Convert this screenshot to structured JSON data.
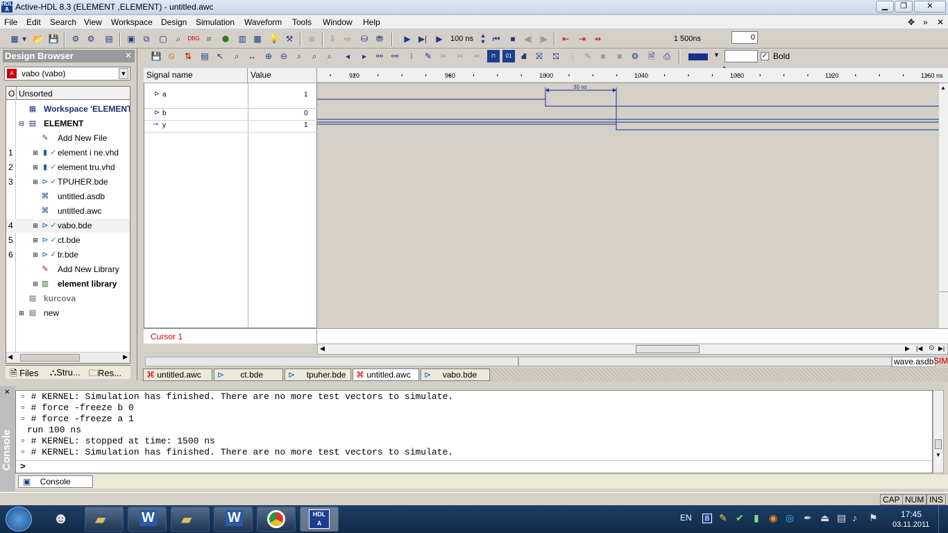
{
  "window": {
    "title": "Active-HDL 8.3 (ELEMENT ,ELEMENT) - untitled.awc",
    "app_icon_text": "HDL A"
  },
  "menu": [
    "File",
    "Edit",
    "Search",
    "View",
    "Workspace",
    "Design",
    "Simulation",
    "Waveform",
    "Tools",
    "Window",
    "Help"
  ],
  "toolbar": {
    "run_step": "100 ns",
    "sim_time": "1 500ns",
    "plus": "+",
    "delta": "0"
  },
  "wave_toolbar": {
    "bold_label": "Bold",
    "bold_checked": true
  },
  "design_browser": {
    "title": "Design Browser",
    "selected_unit": "vabo (vabo)",
    "sort_header": "Unsorted",
    "sort_col": "O",
    "items": [
      {
        "num": "",
        "label": "Workspace 'ELEMENT'",
        "bold": true
      },
      {
        "num": "",
        "label": "ELEMENT",
        "bold": true
      },
      {
        "num": "",
        "label": "Add New File",
        "bold": false
      },
      {
        "num": "1",
        "label": "element i ne.vhd",
        "bold": false
      },
      {
        "num": "2",
        "label": "element tru.vhd",
        "bold": false
      },
      {
        "num": "3",
        "label": "TPUHER.bde",
        "bold": false
      },
      {
        "num": "",
        "label": "untitled.asdb",
        "bold": false
      },
      {
        "num": "",
        "label": "untitled.awc",
        "bold": false
      },
      {
        "num": "4",
        "label": "vabo.bde",
        "bold": false
      },
      {
        "num": "5",
        "label": "ct.bde",
        "bold": false
      },
      {
        "num": "6",
        "label": "tr.bde",
        "bold": false
      },
      {
        "num": "",
        "label": "Add New Library",
        "bold": false
      },
      {
        "num": "",
        "label": "element library",
        "bold": true
      },
      {
        "num": "",
        "label": "kurcova",
        "bold": true
      },
      {
        "num": "",
        "label": "new",
        "bold": false
      }
    ],
    "tabs": [
      "Files",
      "Stru...",
      "Res..."
    ]
  },
  "waveform": {
    "col_signal": "Signal name",
    "col_value": "Value",
    "ticks": [
      "920",
      "960",
      "1000",
      "1040",
      "1080",
      "1120",
      "1160"
    ],
    "tick_unit": "ns",
    "signals": [
      {
        "name": "a",
        "value": "1"
      },
      {
        "name": "b",
        "value": "0"
      },
      {
        "name": "y",
        "value": "1"
      }
    ],
    "measure_label": "30 ns",
    "cursor_label": "Cursor 1",
    "status_file": "wave.asdb",
    "status_mode": "SIM"
  },
  "doc_tabs": [
    "untitled.awc",
    "ct.bde",
    "tpuher.bde",
    "untitled.awc",
    "vabo.bde"
  ],
  "console": {
    "title": "Console",
    "lines": [
      "# KERNEL: Simulation has finished. There are no more test vectors to simulate.",
      "# force -freeze b 0",
      "# force -freeze a 1",
      "run 100 ns",
      "# KERNEL: stopped at time: 1500 ns",
      "# KERNEL: Simulation has finished. There are no more test vectors to simulate."
    ],
    "prompt": ">",
    "tab": "Console"
  },
  "statusbar": [
    "CAP",
    "NUM",
    "INS"
  ],
  "taskbar": {
    "lang": "EN",
    "time": "17:45",
    "date": "03.11.2011"
  }
}
